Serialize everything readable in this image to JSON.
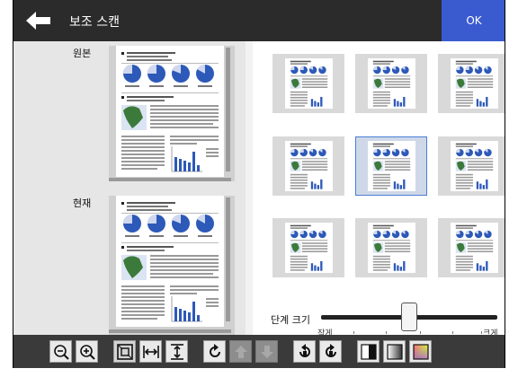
{
  "header": {
    "title": "보조 스캔",
    "ok_label": "OK"
  },
  "left": {
    "original_label": "원본",
    "current_label": "현재"
  },
  "slider": {
    "label": "단계 크기",
    "min_label": "작게",
    "max_label": "크게",
    "value_fraction": 0.5
  },
  "grid": {
    "rows": 3,
    "cols": 3,
    "selected_index": 4
  },
  "colors": {
    "accent": "#3a5bd0",
    "selection_border": "#4a7fd6",
    "chart_blue": "#2d59b8",
    "map_green": "#3c7a3c"
  },
  "toolbar": {
    "buttons": [
      {
        "icon": "zoom-out-icon"
      },
      {
        "icon": "zoom-in-icon"
      },
      {
        "icon": "fit-page-icon"
      },
      {
        "icon": "fit-width-icon"
      },
      {
        "icon": "fit-height-icon"
      },
      {
        "icon": "rotate-icon"
      },
      {
        "icon": "move-up-icon"
      },
      {
        "icon": "move-down-icon"
      },
      {
        "icon": "rotate-left-icon"
      },
      {
        "icon": "rotate-right-icon"
      },
      {
        "icon": "black-white-icon"
      },
      {
        "icon": "grayscale-icon"
      },
      {
        "icon": "color-icon"
      }
    ]
  }
}
